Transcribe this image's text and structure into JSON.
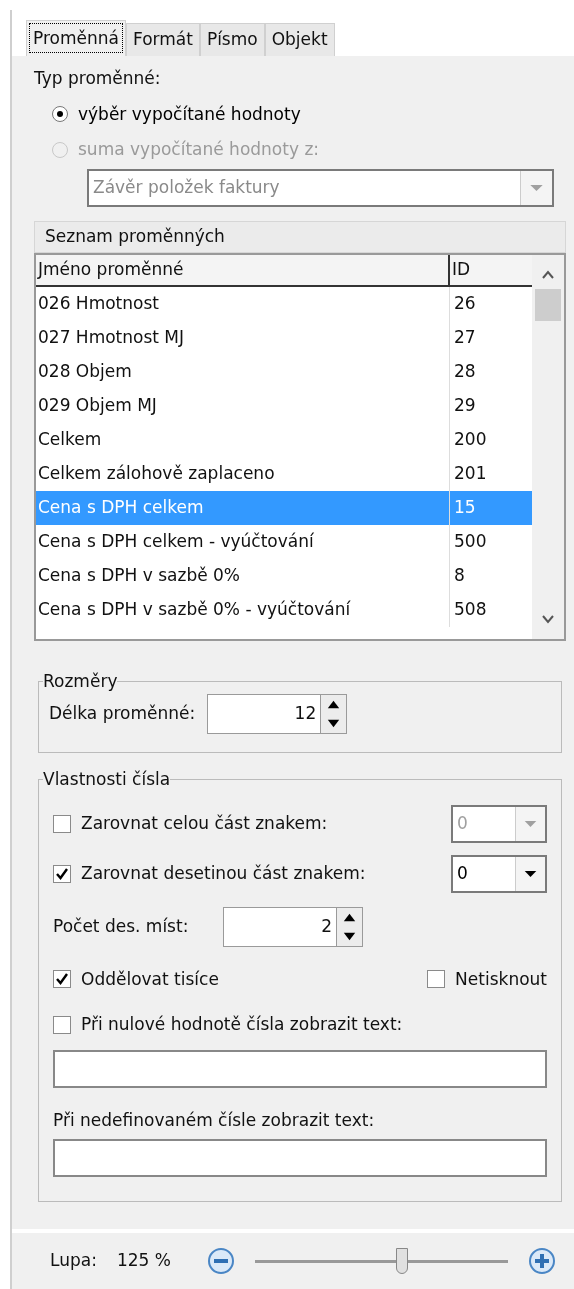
{
  "tabs": [
    {
      "label": "Proměnná",
      "selected": true
    },
    {
      "label": "Formát",
      "selected": false
    },
    {
      "label": "Písmo",
      "selected": false
    },
    {
      "label": "Objekt",
      "selected": false
    }
  ],
  "variable_type": {
    "label": "Typ proměnné:",
    "options": [
      {
        "label": "výběr vypočítané hodnoty",
        "selected": true,
        "disabled": false
      },
      {
        "label": "suma vypočítané hodnoty z:",
        "selected": false,
        "disabled": true
      }
    ],
    "source": {
      "value": "Závěr položek faktury",
      "disabled": true
    }
  },
  "variable_list": {
    "title": "Seznam proměnných",
    "columns": [
      "Jméno proměnné",
      "ID"
    ],
    "rows": [
      {
        "name": "026 Hmotnost",
        "id": "26",
        "selected": false
      },
      {
        "name": "027 Hmotnost MJ",
        "id": "27",
        "selected": false
      },
      {
        "name": "028 Objem",
        "id": "28",
        "selected": false
      },
      {
        "name": "029 Objem MJ",
        "id": "29",
        "selected": false
      },
      {
        "name": "Celkem",
        "id": "200",
        "selected": false
      },
      {
        "name": "Celkem zálohově zaplaceno",
        "id": "201",
        "selected": false
      },
      {
        "name": "Cena s DPH celkem",
        "id": "15",
        "selected": true
      },
      {
        "name": "Cena s DPH celkem - vyúčtování",
        "id": "500",
        "selected": false
      },
      {
        "name": "Cena s DPH v sazbě 0%",
        "id": "8",
        "selected": false
      },
      {
        "name": "Cena s DPH v sazbě 0% - vyúčtování",
        "id": "508",
        "selected": false
      }
    ]
  },
  "dimensions": {
    "title": "Rozměry",
    "length_label": "Délka proměnné:",
    "length_value": "12"
  },
  "number_properties": {
    "title": "Vlastnosti čísla",
    "align_integer": {
      "label": "Zarovnat celou část znakem:",
      "checked": false,
      "value": "0"
    },
    "align_decimal": {
      "label": "Zarovnat desetinou část znakem:",
      "checked": true,
      "value": "0"
    },
    "decimals_label": "Počet des. míst:",
    "decimals_value": "2",
    "thousands": {
      "label": "Oddělovat tisíce",
      "checked": true
    },
    "no_print": {
      "label": "Netisknout",
      "checked": false
    },
    "zero_text": {
      "label": "Při nulové hodnotě čísla zobrazit text:",
      "checked": false
    },
    "undefined_text_label": "Při nedefinovaném čísle zobrazit text:"
  },
  "zoom": {
    "label": "Lupa:",
    "value": "125 %",
    "level": 0.58
  }
}
